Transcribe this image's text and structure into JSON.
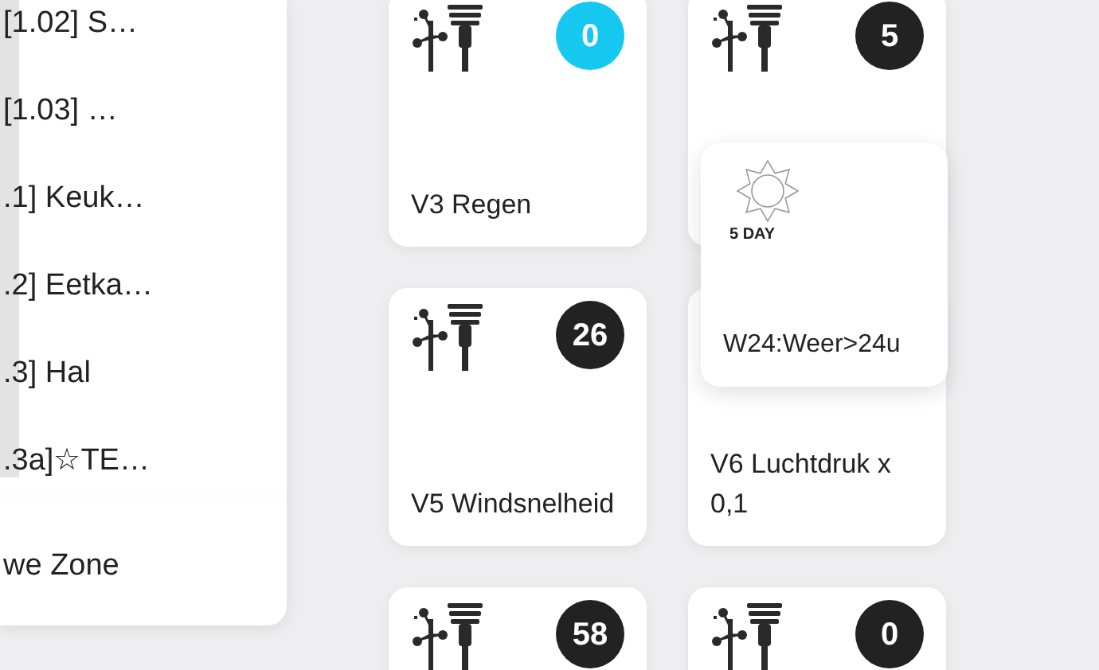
{
  "sidebar": {
    "items": [
      {
        "label": "[1.02] S…"
      },
      {
        "label": "[1.03] …"
      },
      {
        "label": ".1] Keuk…"
      },
      {
        "label": ".2] Eetka…"
      },
      {
        "label": ".3] Hal"
      },
      {
        "label": ".3a]☆TE…"
      }
    ],
    "footer_item": {
      "label": "we Zone"
    }
  },
  "tiles": [
    {
      "label": "V3 Regen",
      "value": "0",
      "color": "#14c8f0"
    },
    {
      "value": "5",
      "color": "#222222"
    },
    {
      "label": "V5 Windsnelheid",
      "value": "26",
      "color": "#222222"
    },
    {
      "label": "V6 Luchtdruk x 0,1"
    },
    {
      "value": "58",
      "color": "#222222"
    },
    {
      "value": "0",
      "color": "#222222"
    }
  ],
  "popup_tile": {
    "icon_caption": "5 DAY",
    "label": "W24:Weer>24u"
  }
}
